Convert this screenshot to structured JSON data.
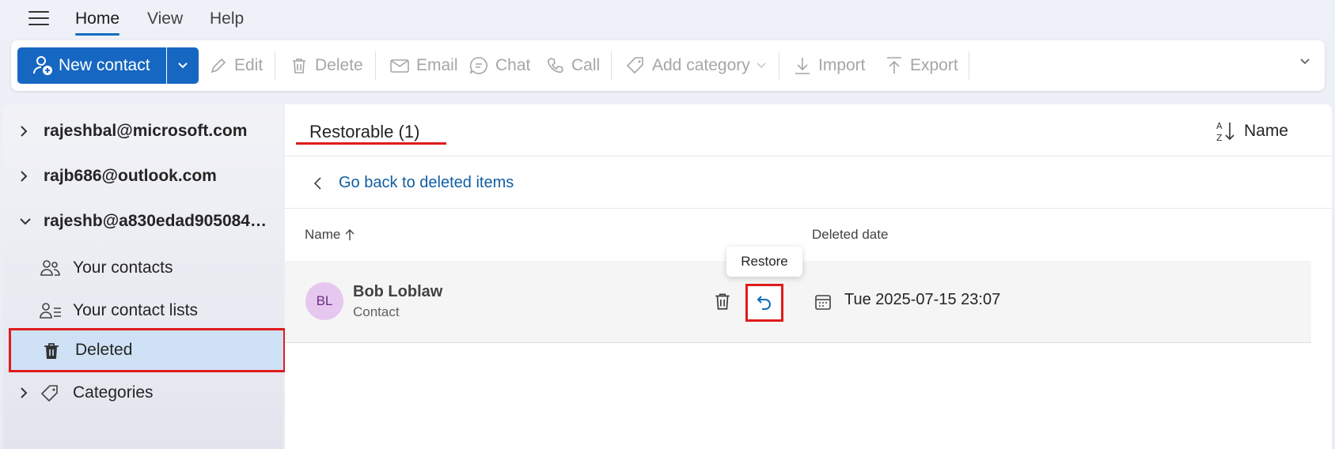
{
  "nav": {
    "tabs": [
      {
        "label": "Home",
        "active": true
      },
      {
        "label": "View",
        "active": false
      },
      {
        "label": "Help",
        "active": false
      }
    ]
  },
  "toolbar": {
    "new_contact": "New contact",
    "edit": "Edit",
    "delete": "Delete",
    "email": "Email",
    "chat": "Chat",
    "call": "Call",
    "add_category": "Add category",
    "import": "Import",
    "export": "Export"
  },
  "sidebar": {
    "accounts": [
      {
        "label": "rajeshbal@microsoft.com",
        "expanded": false
      },
      {
        "label": "rajb686@outlook.com",
        "expanded": false
      },
      {
        "label": "rajeshb@a830edad9050849...",
        "expanded": true
      }
    ],
    "items": [
      {
        "label": "Your contacts",
        "icon": "people-icon"
      },
      {
        "label": "Your contact lists",
        "icon": "contact-list-icon"
      },
      {
        "label": "Deleted",
        "icon": "trash-icon",
        "selected": true
      },
      {
        "label": "Categories",
        "icon": "tag-icon"
      }
    ]
  },
  "main": {
    "title": "Restorable (1)",
    "sort_label": "Name",
    "go_back": "Go back to deleted items",
    "columns": {
      "name": "Name",
      "deleted_date": "Deleted date"
    },
    "rows": [
      {
        "initials": "BL",
        "name": "Bob Loblaw",
        "type": "Contact",
        "deleted_date": "Tue 2025-07-15 23:07"
      }
    ],
    "tooltip": "Restore"
  },
  "colors": {
    "accent": "#1667c2",
    "highlight": "#e01b1b",
    "selected_bg": "#cfe2f5",
    "avatar_bg": "#e6c7ef"
  }
}
